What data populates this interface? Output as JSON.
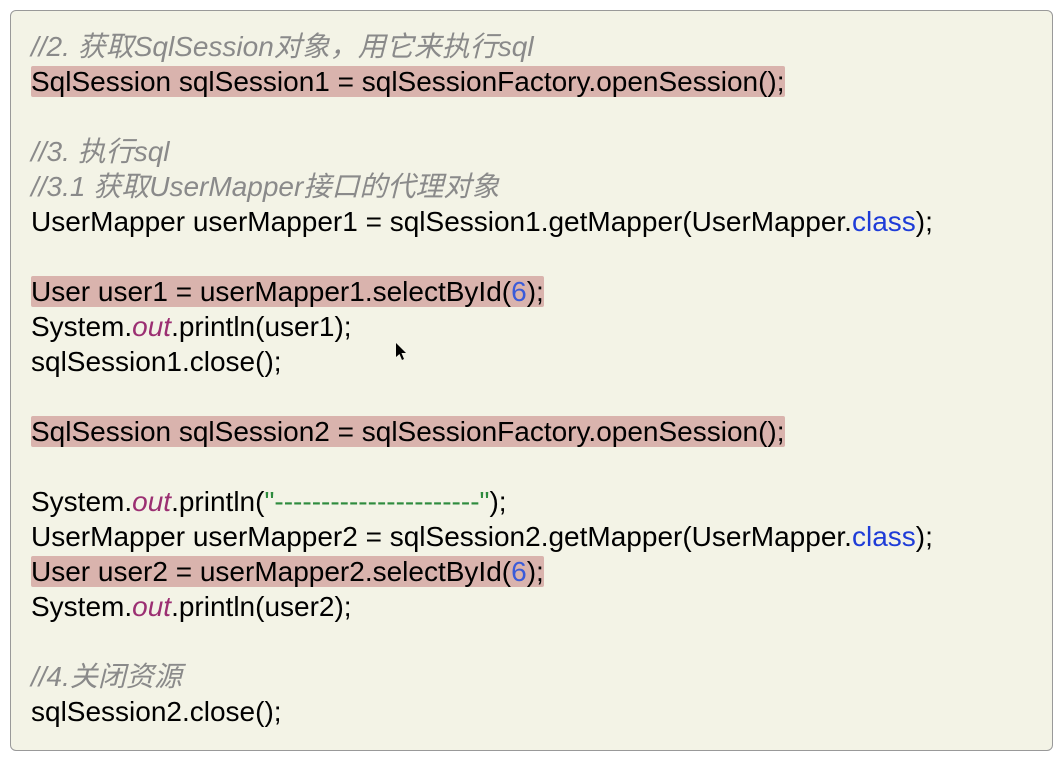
{
  "code": {
    "comment2": "//2. 获取SqlSession对象，用它来执行sql",
    "line2": "SqlSession sqlSession1 = sqlSessionFactory.openSession();",
    "comment3": "//3. 执行sql",
    "comment31": "//3.1 获取UserMapper接口的代理对象",
    "line_mapper1_a": "UserMapper userMapper1 = sqlSession1.getMapper(UserMapper.",
    "keyword_class": "class",
    "line_mapper1_c": ");",
    "line_user1_a": "User user1 = userMapper1.selectById(",
    "num_6": "6",
    "line_user1_c": ");",
    "sys_a": "System.",
    "field_out": "out",
    "println_user1": ".println(user1);",
    "close1": "sqlSession1.close();",
    "session2": "SqlSession sqlSession2 = sqlSessionFactory.openSession();",
    "println_str_a": ".println(",
    "str_dash": "\"----------------------\"",
    "println_str_c": ");",
    "line_mapper2_a": "UserMapper userMapper2 = sqlSession2.getMapper(UserMapper.",
    "line_mapper2_c": ");",
    "line_user2_a": "User user2 = userMapper2.selectById(",
    "line_user2_c": ");",
    "println_user2": ".println(user2);",
    "comment4": "//4.关闭资源",
    "close2": "sqlSession2.close();"
  },
  "cursor_glyph": "➤"
}
